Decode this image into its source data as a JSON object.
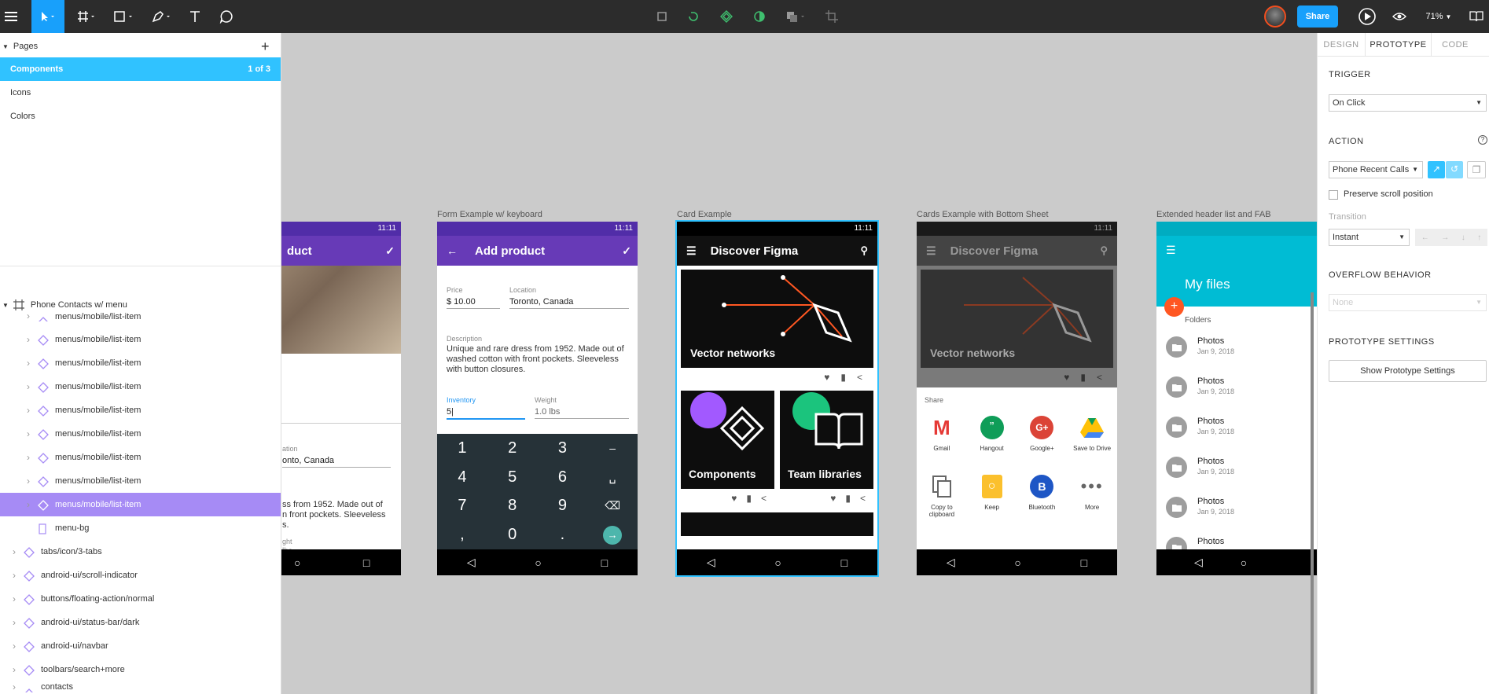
{
  "toolbar": {
    "share_label": "Share",
    "zoom": "71%"
  },
  "pages": {
    "header": "Pages",
    "items": [
      {
        "label": "Components",
        "count": "1 of 3"
      },
      {
        "label": "Icons"
      },
      {
        "label": "Colors"
      }
    ]
  },
  "layers": {
    "group": "Phone Contacts w/ menu",
    "clipped_item": "menus/mobile/list-item",
    "items": [
      "menus/mobile/list-item",
      "menus/mobile/list-item",
      "menus/mobile/list-item",
      "menus/mobile/list-item",
      "menus/mobile/list-item",
      "menus/mobile/list-item",
      "menus/mobile/list-item",
      "menus/mobile/list-item"
    ],
    "menu_bg": "menu-bg",
    "components": [
      "tabs/icon/3-tabs",
      "android-ui/scroll-indicator",
      "buttons/floating-action/normal",
      "android-ui/status-bar/dark",
      "android-ui/navbar",
      "toolbars/search+more"
    ],
    "last": "contacts"
  },
  "right_panel": {
    "tabs": [
      "DESIGN",
      "PROTOTYPE",
      "CODE"
    ],
    "trigger_label": "TRIGGER",
    "trigger_value": "On Click",
    "action_label": "ACTION",
    "action_value": "Phone Recent Calls",
    "preserve_label": "Preserve scroll position",
    "transition_label": "Transition",
    "transition_value": "Instant",
    "overflow_label": "OVERFLOW BEHAVIOR",
    "overflow_value": "None",
    "proto_settings_label": "PROTOTYPE SETTINGS",
    "proto_settings_button": "Show Prototype Settings"
  },
  "frames": {
    "f1": {
      "title": "duct",
      "time": "11:11",
      "location_label": "ation",
      "location_value": "onto, Canada",
      "desc": "ss from 1952. Made out of",
      "desc2": "n front pockets. Sleeveless",
      "desc3": "s.",
      "weight_label": "ght",
      "weight_value": "lbs"
    },
    "f2": {
      "label": "Form Example w/ keyboard",
      "time": "11:11",
      "title": "Add product",
      "price_label": "Price",
      "price_value": "$ 10.00",
      "location_label": "Location",
      "location_value": "Toronto, Canada",
      "desc_label": "Description",
      "desc_value": "Unique and rare dress from 1952. Made out of washed cotton with front pockets. Sleeveless with button closures.",
      "inventory_label": "Inventory",
      "inventory_value": "5|",
      "weight_label": "Weight",
      "weight_value": "1.0 lbs",
      "keys": [
        "1",
        "2",
        "3",
        "–",
        "4",
        "5",
        "6",
        "␣",
        "7",
        "8",
        "9",
        "⌫",
        ",",
        "0",
        ".",
        "→"
      ]
    },
    "f3": {
      "label": "Card Example",
      "time": "11:11",
      "title": "Discover Figma",
      "card1": "Vector networks",
      "card2": "Components",
      "card3": "Team libraries"
    },
    "f4": {
      "label": "Cards Example with Bottom Sheet",
      "time": "11:11",
      "title": "Discover Figma",
      "card1": "Vector networks",
      "share_label": "Share",
      "apps": [
        "Gmail",
        "Hangout",
        "Google+",
        "Save to Drive",
        "Copy to clipboard",
        "Keep",
        "Bluetooth",
        "More"
      ]
    },
    "f5": {
      "label": "Extended header list and FAB",
      "title": "My files",
      "folders_label": "Folders",
      "items": [
        {
          "name": "Photos",
          "date": "Jan 9, 2018"
        },
        {
          "name": "Photos",
          "date": "Jan 9, 2018"
        },
        {
          "name": "Photos",
          "date": "Jan 9, 2018"
        },
        {
          "name": "Photos",
          "date": "Jan 9, 2018"
        },
        {
          "name": "Photos",
          "date": "Jan 9, 2018"
        },
        {
          "name": "Photos",
          "date": ""
        }
      ]
    }
  },
  "colors": {
    "accent_blue": "#30c2ff",
    "selection_purple": "#a68bf5",
    "android_purple": "#673ab7",
    "teal": "#00bcd4",
    "fab_orange": "#ff5722"
  }
}
